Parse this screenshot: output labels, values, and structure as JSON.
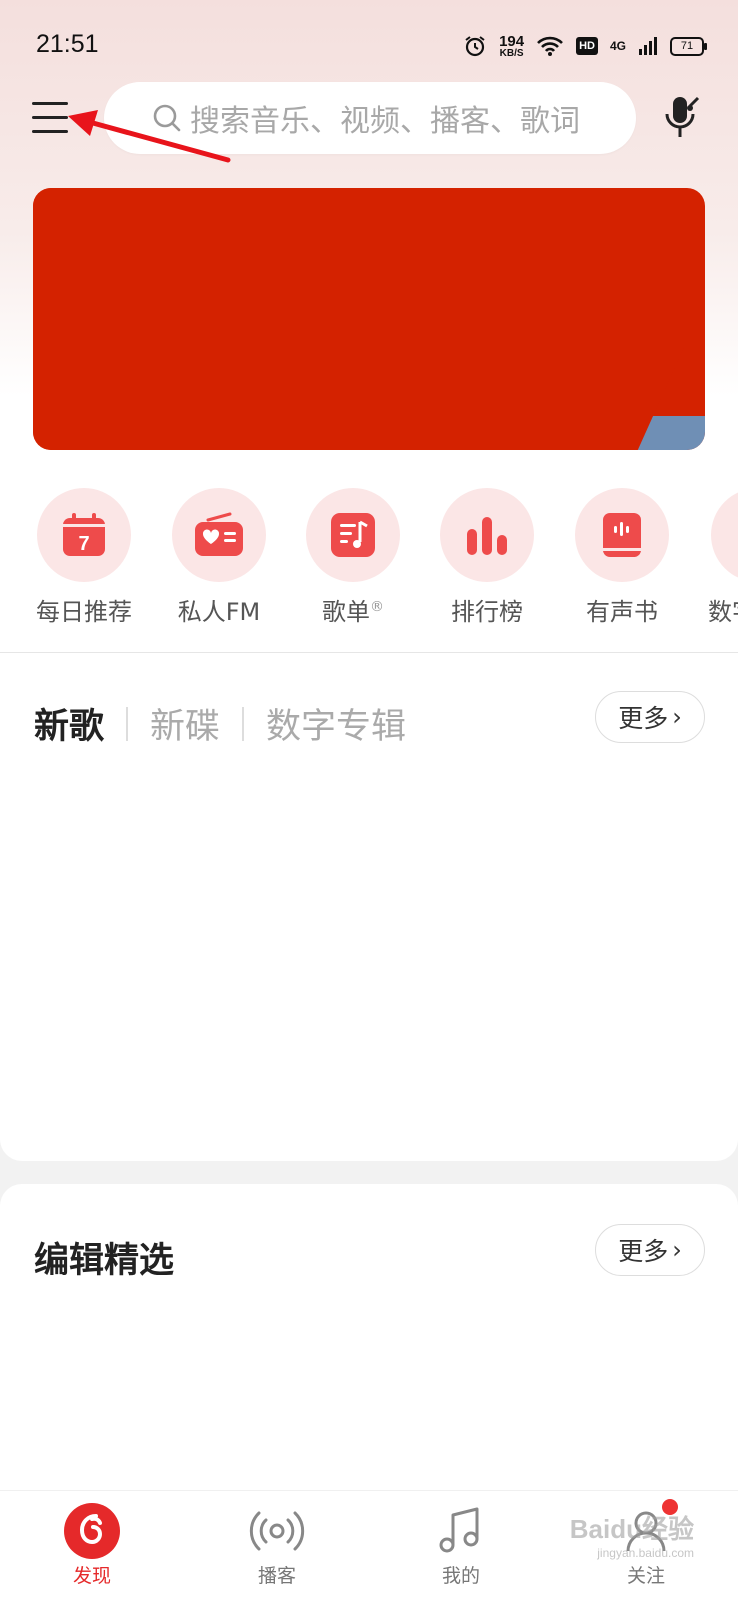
{
  "status": {
    "time": "21:51",
    "speed_value": "194",
    "speed_unit": "KB/S",
    "hd": "HD",
    "network": "4G",
    "battery": "71"
  },
  "search": {
    "placeholder": "搜索音乐、视频、播客、歌词"
  },
  "quick_actions": [
    {
      "label": "每日推荐",
      "icon": "calendar-icon",
      "badge": "7"
    },
    {
      "label": "私人FM",
      "icon": "radio-icon"
    },
    {
      "label": "歌单",
      "icon": "playlist-icon",
      "sup": "®"
    },
    {
      "label": "排行榜",
      "icon": "chart-bars-icon"
    },
    {
      "label": "有声书",
      "icon": "book-icon"
    },
    {
      "label": "数字",
      "icon": "digital-icon"
    }
  ],
  "new_music": {
    "tabs": [
      "新歌",
      "新碟",
      "数字专辑"
    ],
    "more_label": "更多"
  },
  "editor_picks": {
    "title": "编辑精选",
    "more_label": "更多"
  },
  "bottom_nav": [
    {
      "label": "发现",
      "icon": "discover-icon",
      "active": true
    },
    {
      "label": "播客",
      "icon": "podcast-icon"
    },
    {
      "label": "我的",
      "icon": "music-note-icon"
    },
    {
      "label": "关注",
      "icon": "follow-icon"
    }
  ],
  "watermark": {
    "text": "Baidu经验",
    "sub": "jingyan.baidu.com"
  },
  "colors": {
    "accent": "#e5292a",
    "banner": "#d42200",
    "icon_bg": "#fbe6e6",
    "annotation_arrow": "#e8141b"
  }
}
